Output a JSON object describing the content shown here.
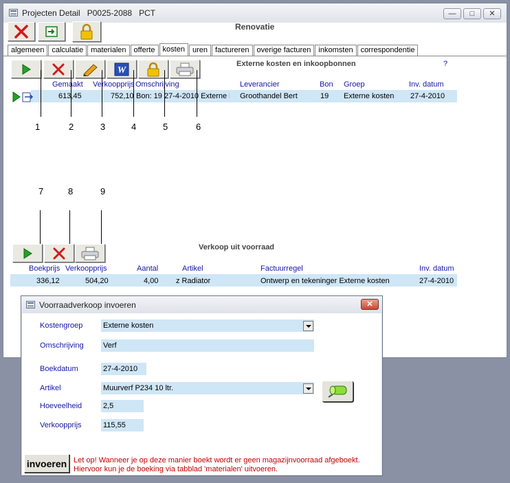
{
  "window": {
    "title": "Projecten Detail   P0025-2088   PCT",
    "controls": {
      "minimize": "—",
      "maximize": "□",
      "close": "✕"
    }
  },
  "header": {
    "project_name": "Renovatie"
  },
  "main_toolbar": {
    "buttons": [
      "delete-icon",
      "exit-icon",
      "lock-icon"
    ]
  },
  "tabs": [
    {
      "label": "algemeen"
    },
    {
      "label": "calculatie"
    },
    {
      "label": "materialen"
    },
    {
      "label": "offerte"
    },
    {
      "label": "kosten",
      "active": true
    },
    {
      "label": "uren"
    },
    {
      "label": "factureren"
    },
    {
      "label": "overige facturen"
    },
    {
      "label": "inkomsten"
    },
    {
      "label": "correspondentie"
    }
  ],
  "external_costs": {
    "title": "Externe kosten en inkoopbonnen",
    "help": "?",
    "columns": {
      "gemaakt": "Gemaakt",
      "verkoopprijs": "Verkoopprijs",
      "omschrijving": "Omschrijving",
      "leverancier": "Leverancier",
      "bon": "Bon",
      "groep": "Groep",
      "inv_datum": "Inv. datum"
    },
    "row": {
      "gemaakt": "613,45",
      "verkoopprijs": "752,10",
      "omschrijving": "Bon: 19 27-4-2010 Externe l",
      "leverancier": "Groothandel Bert",
      "bon": "19",
      "groep": "Externe kosten",
      "inv_datum": "27-4-2010"
    }
  },
  "annotations_top": [
    "1",
    "2",
    "3",
    "4",
    "5",
    "6"
  ],
  "annotations_bottom": [
    "7",
    "8",
    "9"
  ],
  "stock_sales": {
    "title": "Verkoop uit voorraad",
    "columns": {
      "boekprijs": "Boekprijs",
      "verkoopprijs": "Verkoopprijs",
      "aantal": "Aantal",
      "artikel": "Artikel",
      "factuurregel": "Factuurregel",
      "inv_datum": "Inv. datum"
    },
    "row": {
      "boekprijs": "336,12",
      "verkoopprijs": "504,20",
      "aantal": "4,00",
      "artikel": "z Radiator",
      "factuurregel": "Ontwerp en tekeninger Externe kosten",
      "inv_datum": "27-4-2010"
    }
  },
  "dialog": {
    "title": "Voorraadverkoop invoeren",
    "close": "✕",
    "fields": {
      "kostengroep": {
        "label": "Kostengroep",
        "value": "Externe kosten"
      },
      "omschrijving": {
        "label": "Omschrijving",
        "value": "Verf"
      },
      "boekdatum": {
        "label": "Boekdatum",
        "value": "27-4-2010"
      },
      "artikel": {
        "label": "Artikel",
        "value": "Muurverf P234 10 ltr."
      },
      "hoeveelheid": {
        "label": "Hoeveelheid",
        "value": "2,5"
      },
      "verkoopprijs": {
        "label": "Verkoopprijs",
        "value": "115,55"
      }
    },
    "submit_label": "invoeren",
    "warning_line1": "Let op! Wanneer je op deze manier boekt wordt er geen magazijnvoorraad afgeboekt.",
    "warning_line2": "Hiervoor kun je de boeking via tabblad 'materialen' uitvoeren."
  },
  "colors": {
    "row_highlight": "#cfe6f6",
    "header_text": "#1515a8",
    "warning_text": "#c40000"
  }
}
